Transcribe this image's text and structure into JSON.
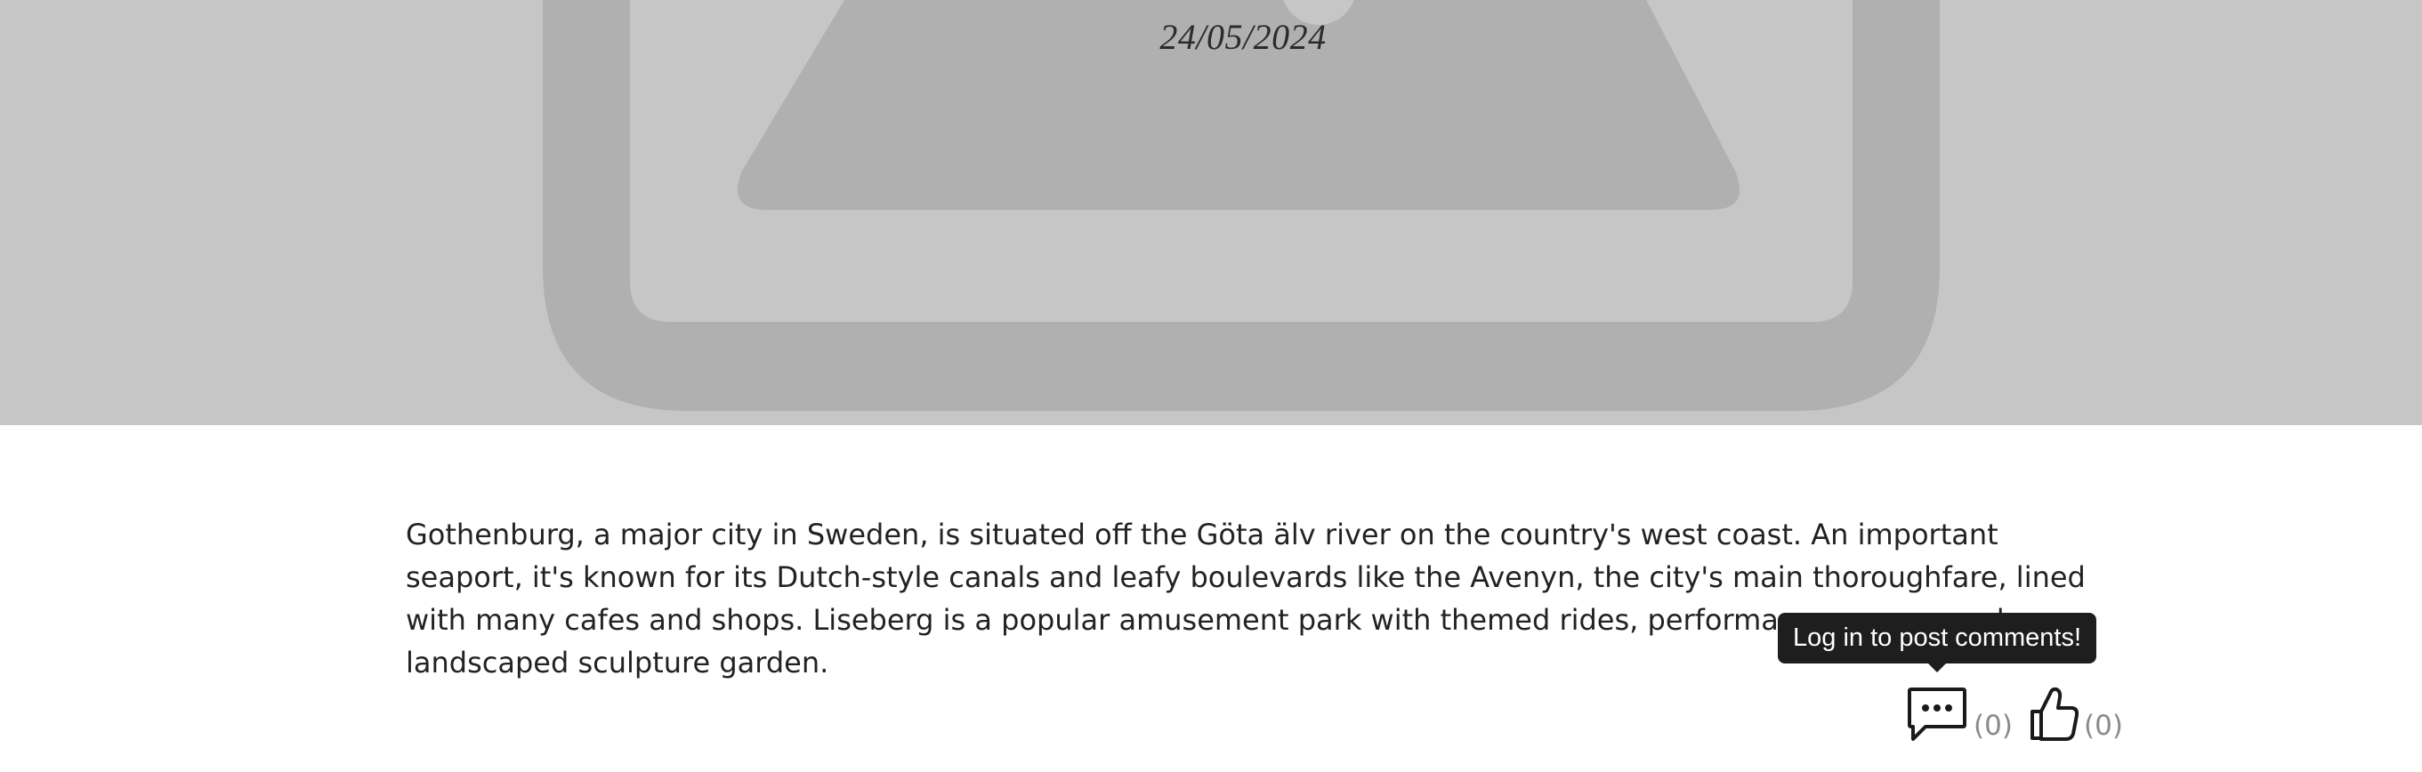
{
  "article": {
    "date": "24/05/2024",
    "body": "Gothenburg, a major city in Sweden, is situated off the Göta älv river on the country's west coast. An important seaport, it's known for its Dutch-style canals and leafy boulevards like the Avenyn, the city's main thoroughfare, lined with many cafes and shops. Liseberg is a popular amusement park with themed rides, performance venues and a landscaped sculpture garden."
  },
  "hero": {
    "icon": "image-placeholder-icon",
    "background_color": "#c6c6c6",
    "icon_color": "#b0b0b0"
  },
  "actions": {
    "tooltip": "Log in to post comments!",
    "comments": {
      "icon": "comment-icon",
      "count": "(0)"
    },
    "likes": {
      "icon": "thumbs-up-icon",
      "count": "(0)"
    }
  }
}
